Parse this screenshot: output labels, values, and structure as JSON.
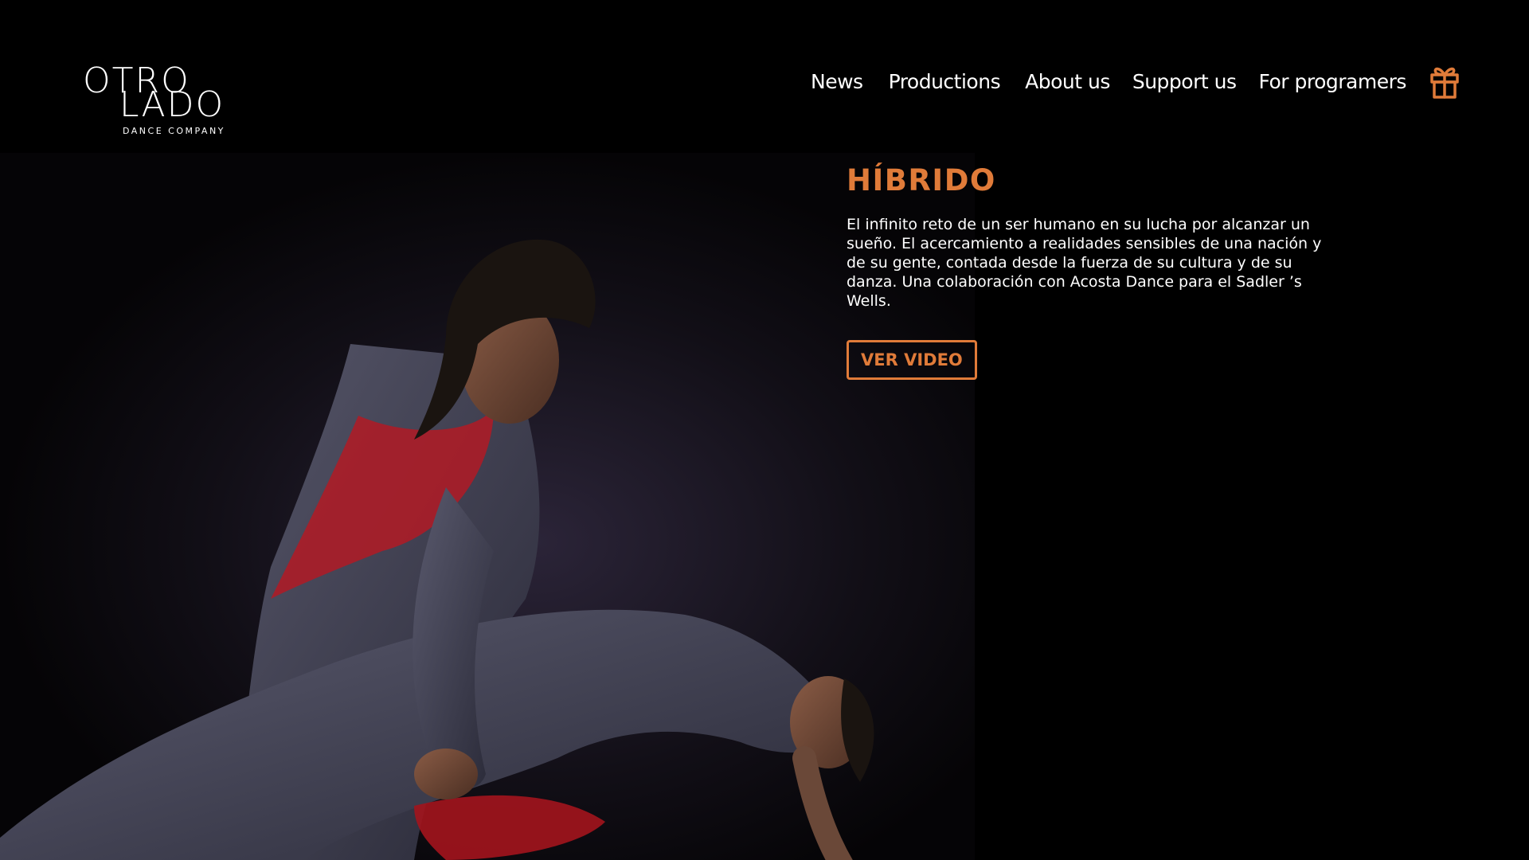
{
  "logo": {
    "line1": "OTRO",
    "line2": "LADO",
    "subtitle": "DANCE COMPANY"
  },
  "nav": {
    "items": [
      {
        "label": "News"
      },
      {
        "label": "Productions"
      },
      {
        "label": "About us"
      },
      {
        "label": "Support us"
      },
      {
        "label": "For programers"
      }
    ],
    "gift_icon": "gift-icon"
  },
  "hero": {
    "image": "dancers-photo",
    "title": "HÍBRIDO",
    "description": "El infinito reto de un ser humano en su lucha por alcanzar un sueño. El acercamiento a realidades sensibles de una nación y de su gente, contada desde la fuerza de su cultura y de su danza. Una colaboración con Acosta Dance para el Sadler ’s Wells.",
    "button_label": "VER VIDEO"
  },
  "colors": {
    "accent": "#e07b39",
    "background": "#000000",
    "text": "#ffffff"
  }
}
